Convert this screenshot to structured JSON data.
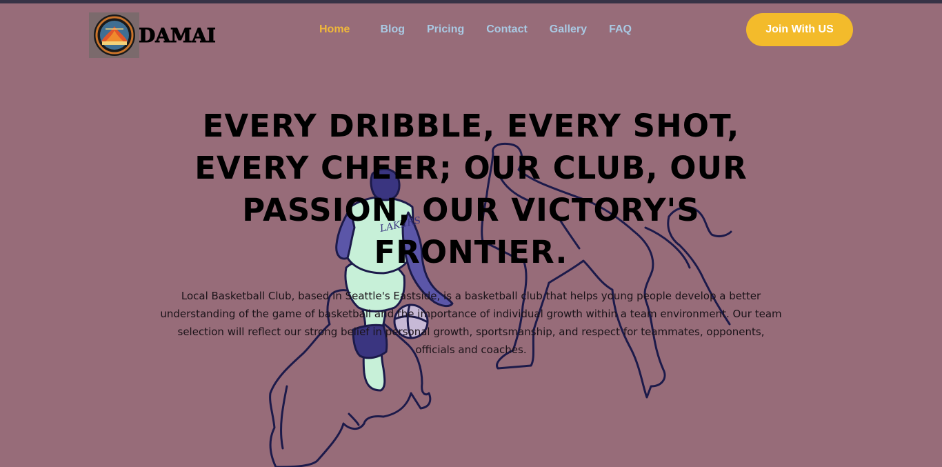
{
  "brand": {
    "name": "DAMAI",
    "logo_icon": "basketball-club-crest"
  },
  "nav": {
    "items": [
      {
        "label": "Home",
        "active": true
      },
      {
        "label": "Blog",
        "active": false
      },
      {
        "label": "Pricing",
        "active": false
      },
      {
        "label": "Contact",
        "active": false
      },
      {
        "label": "Gallery",
        "active": false
      },
      {
        "label": "FAQ",
        "active": false
      }
    ],
    "cta_label": "Join With US"
  },
  "hero": {
    "headline": "EVERY DRIBBLE, EVERY SHOT, EVERY CHEER; OUR CLUB, OUR PASSION, OUR VICTORY'S FRONTIER.",
    "description": "Local Basketball Club, based in Seattle's Eastside, is a basketball club that helps young people develop a better understanding of the game of basketball and the importance of individual growth within a team environment. Our team selection will reflect our strong belief in personal growth, sportsmanship, and respect for teammates, opponents, officials and coaches.",
    "illustration": "basketball-players-outline"
  },
  "colors": {
    "background": "#976c79",
    "top_strip": "#363346",
    "nav_link": "#a9c9e3",
    "nav_active": "#f0b83a",
    "cta_bg": "#f3bb2b",
    "outline": "#1c1a4a",
    "jersey": "#c7f0d8"
  }
}
